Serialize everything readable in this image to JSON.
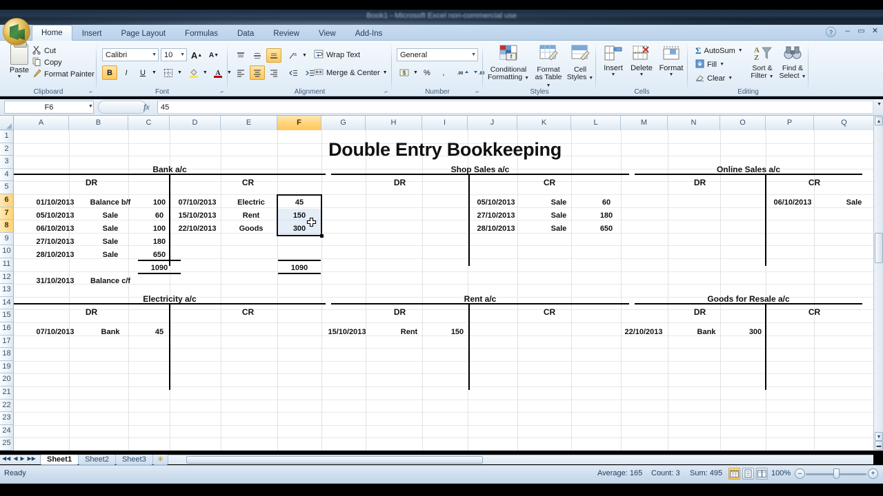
{
  "window": {
    "title": "Book1 - Microsoft Excel non-commercial use",
    "minimize": "–",
    "maximize": "▭",
    "close": "✕",
    "help": "?"
  },
  "ribbon": {
    "tabs": [
      {
        "label": "Home",
        "active": true
      },
      {
        "label": "Insert",
        "active": false
      },
      {
        "label": "Page Layout",
        "active": false
      },
      {
        "label": "Formulas",
        "active": false
      },
      {
        "label": "Data",
        "active": false
      },
      {
        "label": "Review",
        "active": false
      },
      {
        "label": "View",
        "active": false
      },
      {
        "label": "Add-Ins",
        "active": false
      }
    ],
    "groups": {
      "clipboard": {
        "label": "Clipboard",
        "paste": "Paste",
        "cut": "Cut",
        "copy": "Copy",
        "format_painter": "Format Painter"
      },
      "font": {
        "label": "Font",
        "font_name": "Calibri",
        "font_size": "10",
        "grow_font": "A",
        "shrink_font": "A",
        "bold": "B",
        "italic": "I",
        "underline": "U"
      },
      "alignment": {
        "label": "Alignment",
        "wrap_text": "Wrap Text",
        "merge_center": "Merge & Center"
      },
      "number": {
        "label": "Number",
        "format": "General",
        "percent": "%",
        "comma": ","
      },
      "styles": {
        "label": "Styles",
        "conditional_formatting": "Conditional\nFormatting",
        "conditional_formatting_l1": "Conditional",
        "conditional_formatting_l2": "Formatting",
        "format_as_table_l1": "Format",
        "format_as_table_l2": "as Table",
        "cell_styles_l1": "Cell",
        "cell_styles_l2": "Styles"
      },
      "cells": {
        "label": "Cells",
        "insert": "Insert",
        "delete": "Delete",
        "format": "Format"
      },
      "editing": {
        "label": "Editing",
        "autosum": "AutoSum",
        "fill": "Fill",
        "clear": "Clear",
        "sort_filter_l1": "Sort &",
        "sort_filter_l2": "Filter",
        "find_select_l1": "Find &",
        "find_select_l2": "Select"
      }
    }
  },
  "formula_bar": {
    "name_box": "F6",
    "formula": "45"
  },
  "grid": {
    "columns": [
      "A",
      "B",
      "C",
      "D",
      "E",
      "F",
      "G",
      "H",
      "I",
      "J",
      "K",
      "L",
      "M",
      "N",
      "O",
      "P",
      "Q"
    ],
    "selected_column": "F",
    "rows": [
      "1",
      "2",
      "3",
      "4",
      "5",
      "6",
      "7",
      "8",
      "9",
      "10",
      "11",
      "12",
      "13",
      "14",
      "15",
      "16",
      "17",
      "18",
      "19",
      "20",
      "21",
      "22",
      "23",
      "24",
      "25"
    ],
    "selected_rows": [
      "6",
      "7",
      "8"
    ]
  },
  "sheet_content": {
    "title": "Double Entry Bookkeeping",
    "accounts": [
      {
        "name": "Bank a/c",
        "dr_label": "DR",
        "cr_label": "CR",
        "dr_rows": [
          {
            "date": "01/10/2013",
            "detail": "Balance b/f",
            "amount": "100"
          },
          {
            "date": "05/10/2013",
            "detail": "Sale",
            "amount": "60"
          },
          {
            "date": "06/10/2013",
            "detail": "Sale",
            "amount": "100"
          },
          {
            "date": "27/10/2013",
            "detail": "Sale",
            "amount": "180"
          },
          {
            "date": "28/10/2013",
            "detail": "Sale",
            "amount": "650"
          }
        ],
        "dr_total": "1090",
        "dr_balance": {
          "date": "31/10/2013",
          "detail": "Balance c/f",
          "amount": ""
        },
        "cr_rows": [
          {
            "date": "07/10/2013",
            "detail": "Electric",
            "amount": "45"
          },
          {
            "date": "15/10/2013",
            "detail": "Rent",
            "amount": "150"
          },
          {
            "date": "22/10/2013",
            "detail": "Goods",
            "amount": "300"
          }
        ],
        "cr_total": "1090"
      },
      {
        "name": "Shop Sales a/c",
        "dr_label": "DR",
        "cr_label": "CR",
        "dr_rows": [],
        "cr_rows": [
          {
            "date": "05/10/2013",
            "detail": "Sale",
            "amount": "60"
          },
          {
            "date": "27/10/2013",
            "detail": "Sale",
            "amount": "180"
          },
          {
            "date": "28/10/2013",
            "detail": "Sale",
            "amount": "650"
          }
        ]
      },
      {
        "name": "Online Sales a/c",
        "dr_label": "DR",
        "cr_label": "CR",
        "dr_rows": [],
        "cr_rows": [
          {
            "date": "06/10/2013",
            "detail": "Sale",
            "amount": ""
          }
        ]
      },
      {
        "name": "Electricity a/c",
        "dr_label": "DR",
        "cr_label": "CR",
        "dr_rows": [
          {
            "date": "07/10/2013",
            "detail": "Bank",
            "amount": "45"
          }
        ],
        "cr_rows": []
      },
      {
        "name": "Rent a/c",
        "dr_label": "DR",
        "cr_label": "CR",
        "dr_rows": [
          {
            "date": "15/10/2013",
            "detail": "Rent",
            "amount": "150"
          }
        ],
        "cr_rows": []
      },
      {
        "name": "Goods for Resale a/c",
        "dr_label": "DR",
        "cr_label": "CR",
        "dr_rows": [
          {
            "date": "22/10/2013",
            "detail": "Bank",
            "amount": "300"
          }
        ],
        "cr_rows": []
      }
    ]
  },
  "sheet_tabs": {
    "tabs": [
      {
        "label": "Sheet1",
        "active": true
      },
      {
        "label": "Sheet2",
        "active": false
      },
      {
        "label": "Sheet3",
        "active": false
      }
    ],
    "insert_sheet": "✳",
    "nav_first": "◀◀",
    "nav_prev": "◀",
    "nav_next": "▶",
    "nav_last": "▶▶"
  },
  "status_bar": {
    "mode": "Ready",
    "average": "Average: 165",
    "count": "Count: 3",
    "sum": "Sum: 495",
    "zoom": "100%",
    "zoom_out": "–",
    "zoom_in": "+",
    "view_normal": "normal-view",
    "view_page_layout": "page-layout-view",
    "view_page_break": "page-break-view"
  },
  "colors": {
    "accent": "#ffc75c",
    "selection_border": "#0f0f0f",
    "header_blue": "#35506b"
  }
}
